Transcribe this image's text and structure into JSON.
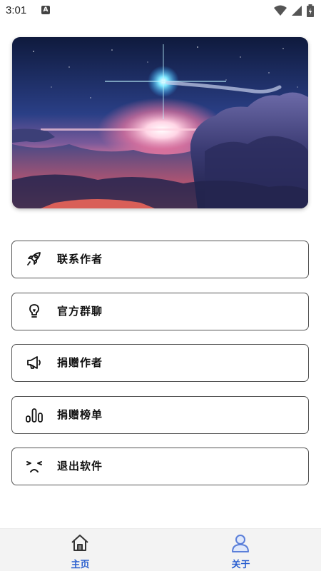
{
  "status_bar": {
    "time": "3:01",
    "notification_badge": "A",
    "icons": [
      "wifi-icon",
      "signal-icon",
      "battery-icon"
    ]
  },
  "banner": {
    "image": "sky-sunset-clouds-with-star"
  },
  "menu": [
    {
      "label": "联系作者",
      "icon": "rocket-icon"
    },
    {
      "label": "官方群聊",
      "icon": "lightbulb-icon"
    },
    {
      "label": "捐赠作者",
      "icon": "megaphone-icon"
    },
    {
      "label": "捐赠榜单",
      "icon": "bar-chart-icon"
    },
    {
      "label": "退出软件",
      "icon": "sad-face-icon"
    }
  ],
  "bottom_nav": {
    "tabs": [
      {
        "label": "主页",
        "icon": "home-icon"
      },
      {
        "label": "关于",
        "icon": "user-icon",
        "active": true
      }
    ],
    "label_color": "#2a5fcf"
  }
}
